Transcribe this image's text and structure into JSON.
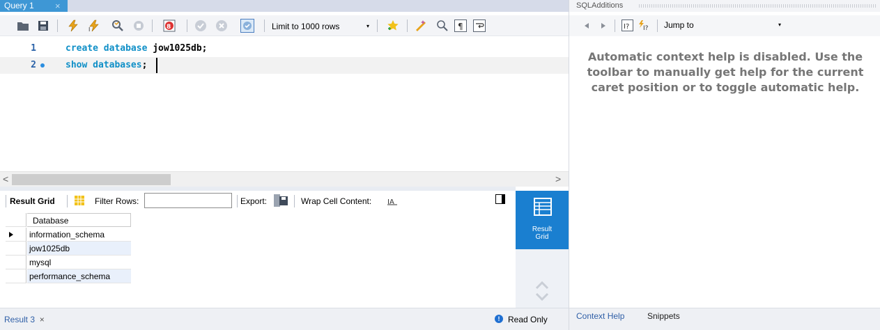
{
  "editor_tab": {
    "label": "Query 1",
    "close": "×"
  },
  "toolbar": {
    "icons": [
      "open-folder-icon",
      "save-icon",
      "execute-icon",
      "execute-current-icon",
      "explain-icon",
      "stop-icon",
      "toggle-error-icon",
      "commit-icon",
      "rollback-icon",
      "autocommit-icon",
      "add-bookmark-icon",
      "beautify-icon",
      "find-icon",
      "invisible-chars-icon",
      "wrap-lines-icon"
    ],
    "limit_label": "Limit to 1000 rows",
    "limit_arrow": "▾"
  },
  "editor": {
    "lines": [
      {
        "number": "1",
        "keyword": "create database",
        "rest": " jow1025db;"
      },
      {
        "number": "2",
        "keyword": "show databases",
        "rest": ";"
      }
    ]
  },
  "scroll": {
    "left_arrow": "<",
    "right_arrow": ">"
  },
  "result_toolbar": {
    "result_grid": "Result Grid",
    "filter_rows": "Filter Rows:",
    "filter_value": "",
    "export": "Export:",
    "wrap_cell": "Wrap Cell Content:"
  },
  "grid": {
    "header": "Database",
    "rows": [
      "information_schema",
      "jow1025db",
      "mysql",
      "performance_schema"
    ]
  },
  "side_panel": {
    "button_label_1": "Result",
    "button_label_2": "Grid"
  },
  "bottom": {
    "result_tab": "Result 3",
    "close": "×",
    "read_only": "Read Only",
    "info_glyph": "!"
  },
  "right_panel": {
    "title": "SQLAdditions",
    "jump_to": "Jump to",
    "jump_arrow": "▾",
    "help_text": "Automatic context help is disabled. Use the toolbar to manually get help for the current caret position or to toggle automatic help.",
    "tabs": [
      "Context Help",
      "Snippets"
    ]
  },
  "colors": {
    "accent": "#1a7fd0",
    "tab_active": "#3e97d5",
    "keyword": "#0f8fc7"
  }
}
